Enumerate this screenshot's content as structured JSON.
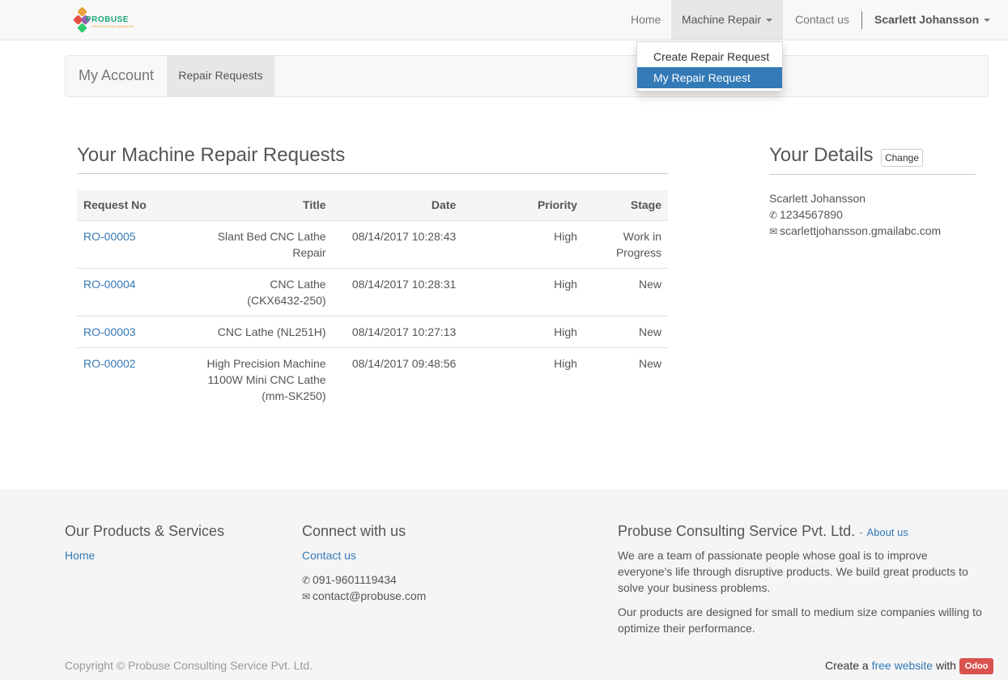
{
  "brand": {
    "logo_text": "PROBUSE",
    "logo_subtext": "PROFESSIONAL BUSINESS"
  },
  "nav": {
    "home": "Home",
    "machine_repair": "Machine Repair",
    "contact": "Contact us",
    "user": "Scarlett Johansson"
  },
  "dropdown": {
    "items": [
      {
        "label": "Create Repair Request",
        "active": false
      },
      {
        "label": "My Repair Request",
        "active": true
      }
    ]
  },
  "account": {
    "title": "My Account",
    "tab": "Repair Requests"
  },
  "requests": {
    "heading": "Your Machine Repair Requests",
    "columns": [
      "Request No",
      "Title",
      "Date",
      "Priority",
      "Stage"
    ],
    "rows": [
      {
        "no": "RO-00005",
        "title": "Slant Bed CNC Lathe Repair",
        "date": "08/14/2017 10:28:43",
        "priority": "High",
        "stage": "Work in Progress"
      },
      {
        "no": "RO-00004",
        "title": "CNC Lathe (CKX6432-250)",
        "date": "08/14/2017 10:28:31",
        "priority": "High",
        "stage": "New"
      },
      {
        "no": "RO-00003",
        "title": "CNC Lathe (NL251H)",
        "date": "08/14/2017 10:27:13",
        "priority": "High",
        "stage": "New"
      },
      {
        "no": "RO-00002",
        "title": "High Precision Machine 1100W Mini CNC Lathe (mm-SK250)",
        "date": "08/14/2017 09:48:56",
        "priority": "High",
        "stage": "New"
      }
    ]
  },
  "details": {
    "heading": "Your Details",
    "change_label": "Change",
    "name": "Scarlett Johansson",
    "phone": "1234567890",
    "email": "scarlettjohansson.gmailabc.com"
  },
  "footer": {
    "products_heading": "Our Products & Services",
    "products_link": "Home",
    "connect_heading": "Connect with us",
    "connect_link": "Contact us",
    "phone": "091-9601119434",
    "email": "contact@probuse.com",
    "company_heading": "Probuse Consulting Service Pvt. Ltd.",
    "about_sep": "-",
    "about_link": "About us",
    "para1": "We are a team of passionate people whose goal is to improve everyone's life through disruptive products. We build great products to solve your business problems.",
    "para2": "Our products are designed for small to medium size companies willing to optimize their performance.",
    "copyright": "Copyright © Probuse Consulting Service Pvt. Ltd.",
    "create_a": "Create a",
    "free_website": "free website",
    "with": "with",
    "odoo": "Odoo"
  }
}
